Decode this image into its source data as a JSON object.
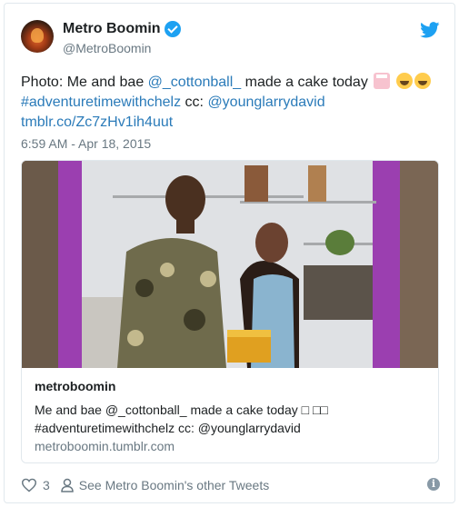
{
  "author": {
    "name": "Metro Boomin",
    "handle": "@MetroBoomin"
  },
  "tweet": {
    "text_prefix": "Photo: Me and bae ",
    "mention_1": "@_cottonball_",
    "text_mid": " made a cake today ",
    "hashtag": "#adventuretimewithchelz",
    "text_cc": " cc: ",
    "mention_2": "@younglarrydavid",
    "link": "tmblr.co/Zc7zHv1ih4uut",
    "timestamp": "6:59 AM - Apr 18, 2015"
  },
  "media_card": {
    "title": "metroboomin",
    "desc_line1": "Me and bae @_cottonball_ made a cake today □ □□",
    "desc_line2": "#adventuretimewithchelz cc: @younglarrydavid",
    "url": "metroboomin.tumblr.com"
  },
  "footer": {
    "like_count": "3",
    "other_tweets": "See Metro Boomin's other Tweets",
    "info_glyph": "i"
  },
  "icons": {
    "verified": "verified-badge-icon",
    "twitter": "twitter-bird-icon",
    "heart": "heart-icon",
    "person": "person-icon",
    "info": "info-icon"
  },
  "colors": {
    "link": "#2b7bb9",
    "twitter_blue": "#1da1f2",
    "muted": "#697882"
  }
}
